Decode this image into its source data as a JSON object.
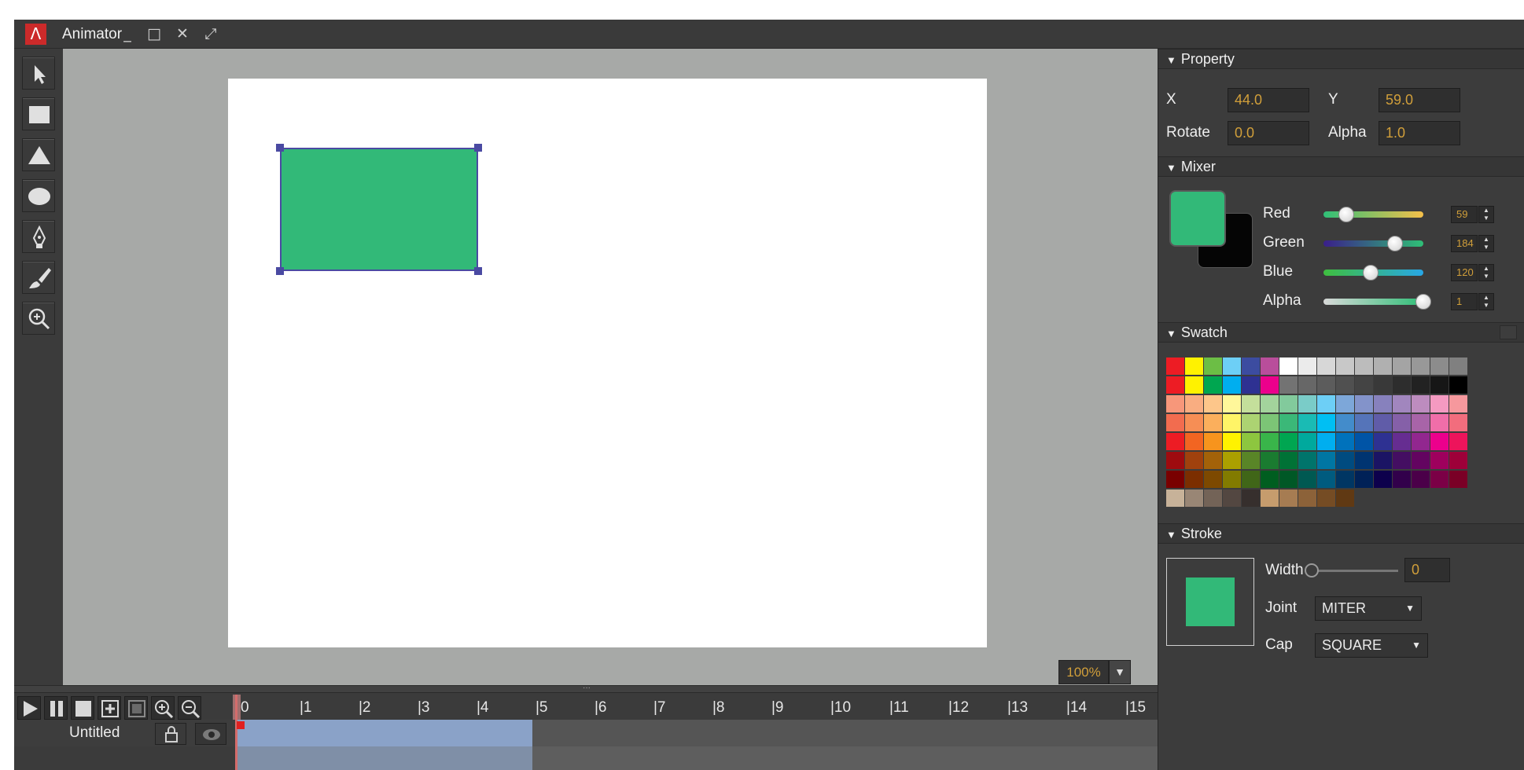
{
  "app": {
    "logo_glyph": "Λ",
    "title": "Animator",
    "window_controls": [
      "_",
      "□",
      "✕",
      "⤢"
    ]
  },
  "toolbox": {
    "tools": [
      {
        "name": "select-tool",
        "icon": "arrow-pointer-icon"
      },
      {
        "name": "rectangle-tool",
        "icon": "rectangle-icon"
      },
      {
        "name": "triangle-tool",
        "icon": "triangle-icon"
      },
      {
        "name": "ellipse-tool",
        "icon": "ellipse-icon"
      },
      {
        "name": "pen-tool",
        "icon": "pen-icon"
      },
      {
        "name": "brush-tool",
        "icon": "brush-icon"
      },
      {
        "name": "zoom-tool",
        "icon": "zoom-in-icon"
      }
    ]
  },
  "stage": {
    "zoom_value": "100%",
    "shape_fill": "#32b978",
    "shape_stroke": "#4a4aa2"
  },
  "timeline": {
    "controls": [
      "play-icon",
      "pause-icon",
      "stop-icon",
      "add-keyframe-icon",
      "remove-keyframe-icon",
      "zoom-in-icon",
      "zoom-out-icon"
    ],
    "ticks": [
      "0",
      "|1",
      "|2",
      "|3",
      "|4",
      "|5",
      "|6",
      "|7",
      "|8",
      "|9",
      "|10",
      "|11",
      "|12",
      "|13",
      "|14",
      "|15"
    ],
    "layer_name": "Untitled",
    "current_frame": 0,
    "keyframe_span_end": 5
  },
  "property": {
    "heading": "Property",
    "x_label": "X",
    "x_value": "44.0",
    "y_label": "Y",
    "y_value": "59.0",
    "rotate_label": "Rotate",
    "rotate_value": "0.0",
    "alpha_label": "Alpha",
    "alpha_value": "1.0"
  },
  "mixer": {
    "heading": "Mixer",
    "fill_color": "#32b978",
    "stroke_color": "#050505",
    "channels": [
      {
        "label": "Red",
        "value": "59",
        "level": 0.23
      },
      {
        "label": "Green",
        "value": "184",
        "level": 0.72
      },
      {
        "label": "Blue",
        "value": "120",
        "level": 0.47
      },
      {
        "label": "Alpha",
        "value": "1",
        "level": 1.0
      }
    ]
  },
  "swatch": {
    "heading": "Swatch",
    "rows": [
      [
        "#ed1c24",
        "#fff200",
        "#6cbe45",
        "#6dcff6",
        "#3c4ca0",
        "#b94e9b",
        "#ffffff",
        "#ebebeb",
        "#d7d7d7",
        "#c8c8c8",
        "#bcbcbc",
        "#b0b0b0",
        "#a4a4a4",
        "#989898",
        "#8c8c8c",
        "#808080"
      ],
      [
        "#ed1c24",
        "#fff200",
        "#00a650",
        "#00aeef",
        "#2e3192",
        "#ec008c",
        "#737373",
        "#676767",
        "#5c5c5c",
        "#505050",
        "#444444",
        "#393939",
        "#2d2d2d",
        "#222222",
        "#161616",
        "#000000"
      ],
      [
        "#f7977a",
        "#f9ad81",
        "#fdc68a",
        "#fff79a",
        "#c4df9b",
        "#a3d39c",
        "#82ca9c",
        "#7accc8",
        "#6dcff6",
        "#7da7d9",
        "#8393ca",
        "#8781bd",
        "#a186be",
        "#bd8cbf",
        "#f49ac1",
        "#f6989d"
      ],
      [
        "#f26c4f",
        "#f68e55",
        "#fbaf5c",
        "#fff467",
        "#acd372",
        "#7cc576",
        "#3bb878",
        "#1abbb4",
        "#00bff3",
        "#438ccb",
        "#5574b9",
        "#605ca8",
        "#8560a8",
        "#a864a8",
        "#f06ea9",
        "#f26d7d"
      ],
      [
        "#ed1c24",
        "#f26522",
        "#f7941d",
        "#fff200",
        "#8dc63f",
        "#39b54a",
        "#00a651",
        "#00a99d",
        "#00aeef",
        "#0072bc",
        "#0054a6",
        "#2e3192",
        "#662d91",
        "#92278f",
        "#ec008c",
        "#ed145b"
      ],
      [
        "#9e0b0f",
        "#a0410d",
        "#a36209",
        "#aba000",
        "#598527",
        "#1a7b30",
        "#007236",
        "#00746b",
        "#0076a3",
        "#004b80",
        "#003471",
        "#1b1464",
        "#440e62",
        "#630460",
        "#9e005d",
        "#9e0039"
      ],
      [
        "#790000",
        "#7b2e00",
        "#7d4900",
        "#827b00",
        "#406618",
        "#005e20",
        "#005826",
        "#005952",
        "#005b7f",
        "#003663",
        "#002157",
        "#0d004c",
        "#32004b",
        "#4b0049",
        "#7b0046",
        "#7a0026"
      ],
      [
        "#c7b299",
        "#998675",
        "#736357",
        "#534741",
        "#362f2d",
        "#c69c6d",
        "#a67c52",
        "#8c6239",
        "#754c24",
        "#603913"
      ]
    ]
  },
  "stroke": {
    "heading": "Stroke",
    "width_label": "Width",
    "width_value": "0",
    "joint_label": "Joint",
    "joint_value": "MITER",
    "cap_label": "Cap",
    "cap_value": "SQUARE",
    "preview_color": "#32b978"
  }
}
